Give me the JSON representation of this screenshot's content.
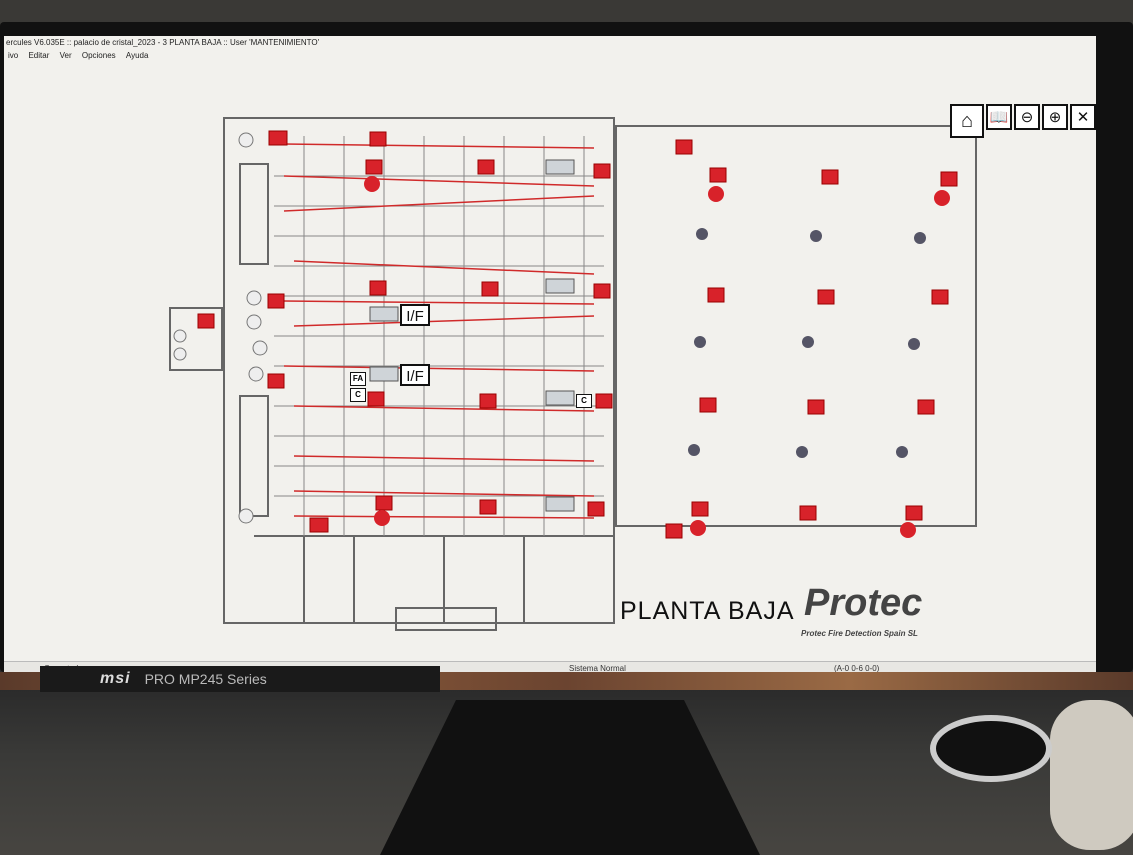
{
  "window": {
    "title": "ercules V6.035E :: palacio de cristal_2023 - 3 PLANTA BAJA :: User 'MANTENIMIENTO'"
  },
  "menu": [
    "ivo",
    "Editar",
    "Ver",
    "Opciones",
    "Ayuda"
  ],
  "toolbar": {
    "buttons": [
      {
        "name": "home-icon",
        "glyph": "⌂"
      },
      {
        "name": "book-icon",
        "glyph": "🕮"
      },
      {
        "name": "zoom-out-icon",
        "glyph": "⊖"
      },
      {
        "name": "zoom-in-icon",
        "glyph": "⊕"
      },
      {
        "name": "close-icon",
        "glyph": "✕"
      }
    ]
  },
  "floor_plan": {
    "title": "PLANTA BAJA",
    "labels": {
      "if_1": "I/F",
      "if_2": "I/F",
      "fa": "FA",
      "c_1": "C",
      "c_2": "C"
    }
  },
  "logo": {
    "name": "Protec",
    "subtitle": "Protec Fire Detection Spain SL"
  },
  "status": {
    "connection": "Conectados",
    "system": "Sistema Normal",
    "address": "(A-0 0-6 0-0)"
  },
  "monitor": {
    "brand": "msi",
    "model": "PRO MP245 Series"
  },
  "colors": {
    "device_red": "#d8222a",
    "wire_red": "#d02a2a",
    "wall_gray": "#666666",
    "screen_bg": "#f2f1ed"
  }
}
